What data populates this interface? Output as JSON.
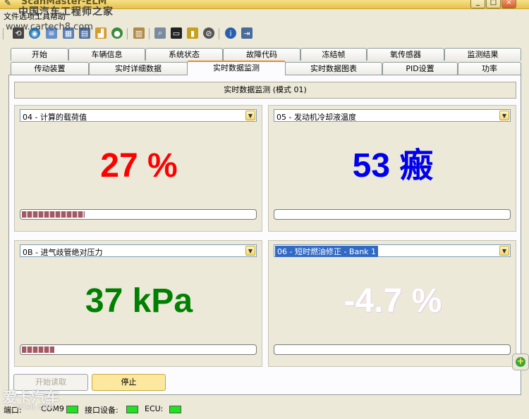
{
  "window": {
    "title": "ScanMaster-ELM"
  },
  "watermark": {
    "site_cn": "中国汽车工程师之家",
    "site_url": "www.cartech8.com",
    "brand": "爱卡汽车",
    "brand_en": "XCAR.COM"
  },
  "menu": [
    "文件",
    "选项",
    "工具",
    "帮助"
  ],
  "toolbar": {
    "icons": [
      "connect-icon",
      "globe-icon",
      "document-icon",
      "table-icon",
      "window-icon",
      "chart-icon",
      "person-icon",
      "clipboard-icon",
      "search-icon",
      "terminal-icon",
      "battery-icon",
      "disc-icon",
      "info-icon",
      "exit-icon"
    ]
  },
  "tabs_row1": [
    "开始",
    "车辆信息",
    "系统状态",
    "故障代码",
    "冻结帧",
    "氧传感器",
    "监测结果"
  ],
  "tabs_row2": [
    "传动装置",
    "实时详细数据",
    "实时数据监测",
    "实时数据图表",
    "PID设置",
    "功率"
  ],
  "active_tab": "实时数据监测",
  "panel_header": "实时数据监测 (模式 01)",
  "gauges": [
    {
      "selector": "04 - 计算的载荷值",
      "value": "27 %",
      "color": "#ff0000",
      "progress": 0.27,
      "selected": false
    },
    {
      "selector": "05 - 发动机冷却液温度",
      "value": "53 瘢",
      "color": "#0000ee",
      "progress": 0.0,
      "selected": false
    },
    {
      "selector": "0B - 进气歧管绝对压力",
      "value": "37 kPa",
      "color": "#008000",
      "progress": 0.14,
      "selected": false
    },
    {
      "selector": "06 - 短时燃油修正 - Bank 1",
      "value": "-4.7 %",
      "color": "#ffffff",
      "progress": 0.0,
      "selected": true
    }
  ],
  "buttons": {
    "start": "开始读取",
    "stop": "停止"
  },
  "status": {
    "port_label": "端口:",
    "port_value": "COM9",
    "interface_label": "接口设备:",
    "ecu_label": "ECU:",
    "led_color": "#22e022"
  }
}
